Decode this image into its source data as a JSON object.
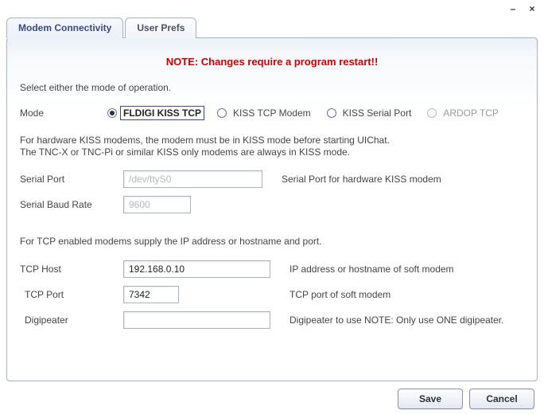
{
  "tabs": {
    "modem": "Modem Connectivity",
    "userPrefs": "User Prefs"
  },
  "note": "NOTE: Changes require a program restart!!",
  "instructions": {
    "selectMode": "Select either the mode of operation.",
    "hardwareInfo1": "For hardware KISS modems, the modem must be in KISS mode before starting UIChat.",
    "hardwareInfo2": "The TNC-X or TNC-Pi or similar KISS only modems are always in KISS mode.",
    "tcpInfo": "For TCP enabled modems supply the IP address or hostname and port."
  },
  "modeLabel": "Mode",
  "modes": {
    "fldigi": "FLDIGI KISS TCP",
    "kissTcp": "KISS TCP Modem",
    "kissSerial": "KISS Serial Port",
    "ardop": "ARDOP TCP"
  },
  "fields": {
    "serialPort": {
      "label": "Serial Port",
      "value": "/dev/ttyS0",
      "hint": "Serial Port for hardware KISS modem"
    },
    "serialBaud": {
      "label": "Serial Baud Rate",
      "value": "9600"
    },
    "tcpHost": {
      "label": "TCP Host",
      "value": "192.168.0.10",
      "hint": "IP address or hostname of soft modem"
    },
    "tcpPort": {
      "label": "TCP Port",
      "value": "7342",
      "hint": "TCP port of soft modem"
    },
    "digipeater": {
      "label": "Digipeater",
      "value": "",
      "hint": "Digipeater to use NOTE: Only use ONE digipeater."
    }
  },
  "buttons": {
    "save": "Save",
    "cancel": "Cancel"
  }
}
